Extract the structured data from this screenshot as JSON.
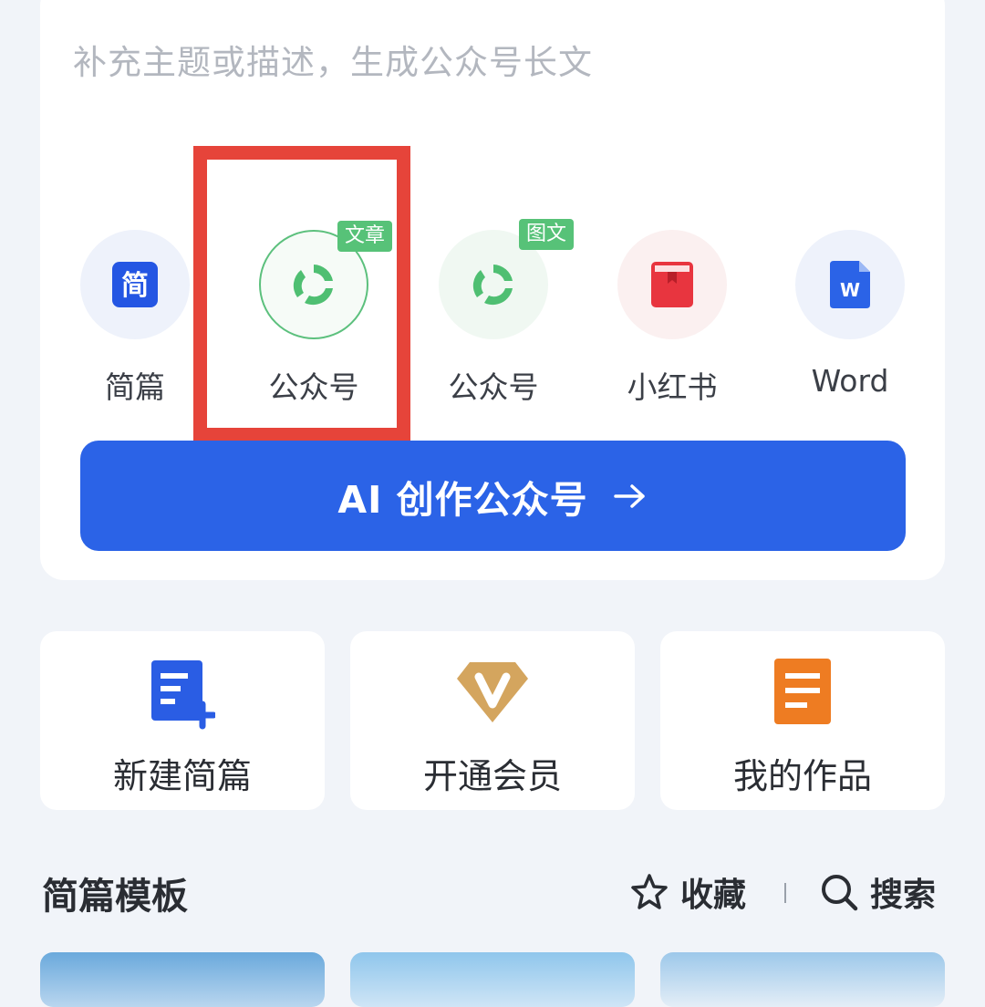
{
  "prompt": {
    "placeholder": "补充主题或描述，生成公众号长文"
  },
  "modes": [
    {
      "label": "简篇",
      "icon": "jianpian-app-icon",
      "selected": false
    },
    {
      "label": "公众号",
      "tag": "文章",
      "icon": "wechat-official-account-icon",
      "selected": true
    },
    {
      "label": "公众号",
      "tag": "图文",
      "icon": "wechat-official-account-icon",
      "selected": false
    },
    {
      "label": "小红书",
      "icon": "xiaohongshu-book-icon",
      "selected": false
    },
    {
      "label": "Word",
      "icon": "word-doc-icon",
      "selected": false
    }
  ],
  "cta": {
    "label": "AI 创作公众号"
  },
  "quick_actions": [
    {
      "label": "新建简篇",
      "icon": "new-document-icon"
    },
    {
      "label": "开通会员",
      "icon": "vip-diamond-icon"
    },
    {
      "label": "我的作品",
      "icon": "my-works-icon"
    }
  ],
  "templates": {
    "title": "简篇模板",
    "favorite_label": "收藏",
    "search_label": "搜索"
  },
  "colors": {
    "primary": "#2b63e7",
    "green": "#57c278",
    "highlight": "#e6443a",
    "background": "#f1f4f9"
  }
}
